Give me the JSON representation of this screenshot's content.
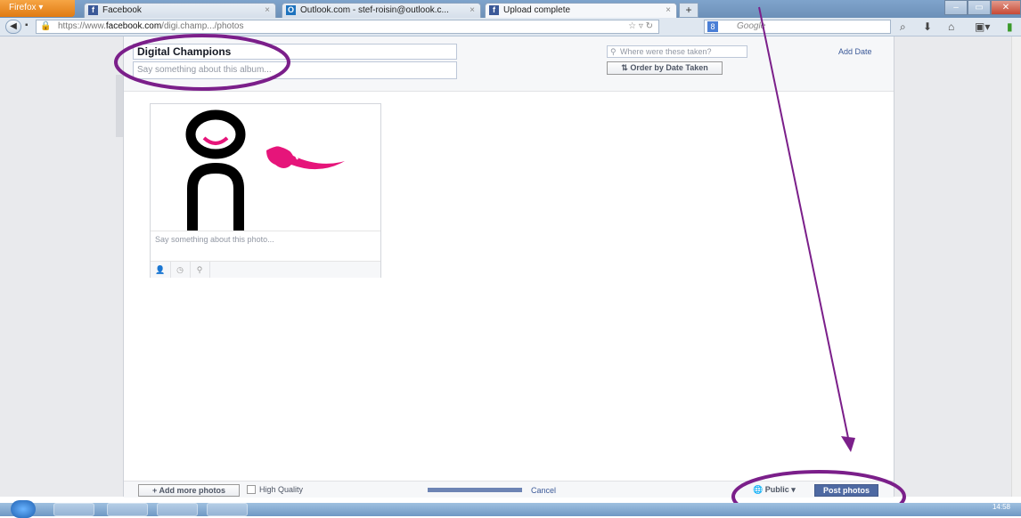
{
  "browser": {
    "menu_label": "Firefox",
    "tabs": [
      {
        "label": "Facebook",
        "icon": "facebook-icon"
      },
      {
        "label": "Outlook.com - stef-roisin@outlook.c...",
        "icon": "outlook-icon"
      },
      {
        "label": "Upload complete",
        "icon": "facebook-icon"
      }
    ],
    "url_prefix": "https://www.",
    "url_domain": "facebook.com",
    "url_path": "/digi.champ.../photos",
    "search_placeholder": "Google"
  },
  "album": {
    "title": "Digital Champions",
    "description_placeholder": "Say something about this album...",
    "location_placeholder": "Where were these taken?",
    "add_date_label": "Add Date",
    "order_button_label": "⇅ Order by Date Taken"
  },
  "photo": {
    "caption_placeholder": "Say something about this photo..."
  },
  "footer": {
    "add_more_label": "+ Add more photos",
    "high_quality_label": "High Quality",
    "upload_progress": 1.0,
    "cancel_label": "Cancel",
    "privacy_label": "Public ▾",
    "post_label": "Post photos"
  },
  "taskbar": {
    "time": "14:58"
  },
  "colors": {
    "facebook_blue": "#3b5998",
    "annotation_purple": "#7b1f8a",
    "logo_pink": "#e6157a"
  }
}
